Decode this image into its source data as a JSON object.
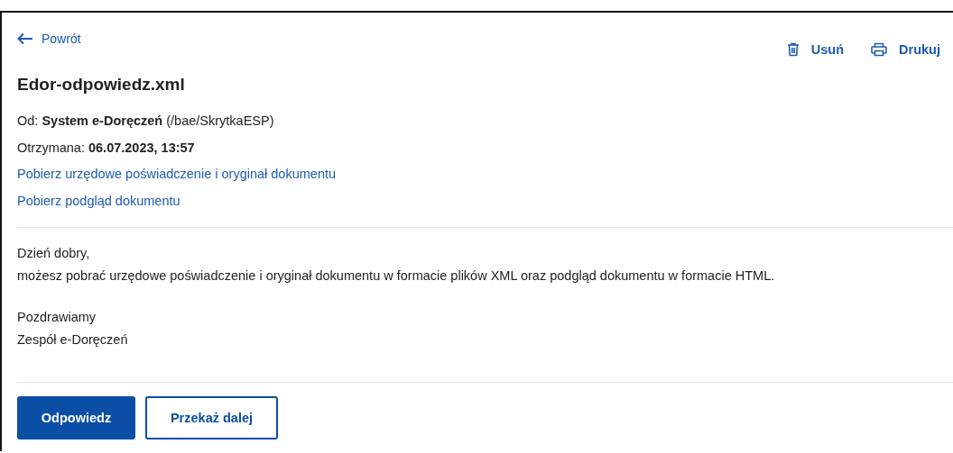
{
  "back_link": {
    "label": "Powrót"
  },
  "actions": [
    {
      "kind": "delete",
      "label": "Usuń"
    },
    {
      "kind": "print",
      "label": "Drukuj"
    }
  ],
  "title": "Edor-odpowiedz.xml",
  "meta": [
    "Od: **System e-Doręczeń** (/bae/SkrytkaESP)",
    "Otrzymana: **06.07.2023, 13:57**"
  ],
  "links": [
    "Pobierz urzędowe poświadczenie i oryginał dokumentu",
    "Pobierz podgląd dokumentu"
  ],
  "body": [
    [
      "Dzień dobry,",
      "możesz pobrać urzędowe poświadczenie i oryginał dokumentu w formacie plików XML oraz podgląd dokumentu w formacie HTML."
    ],
    [
      "Pozdrawiamy",
      "Zespół e-Doręczeń"
    ]
  ],
  "buttons": [
    {
      "kind": "primary",
      "label": "Odpowiedz"
    },
    {
      "kind": "secondary",
      "label": "Przekaż dalej"
    }
  ]
}
